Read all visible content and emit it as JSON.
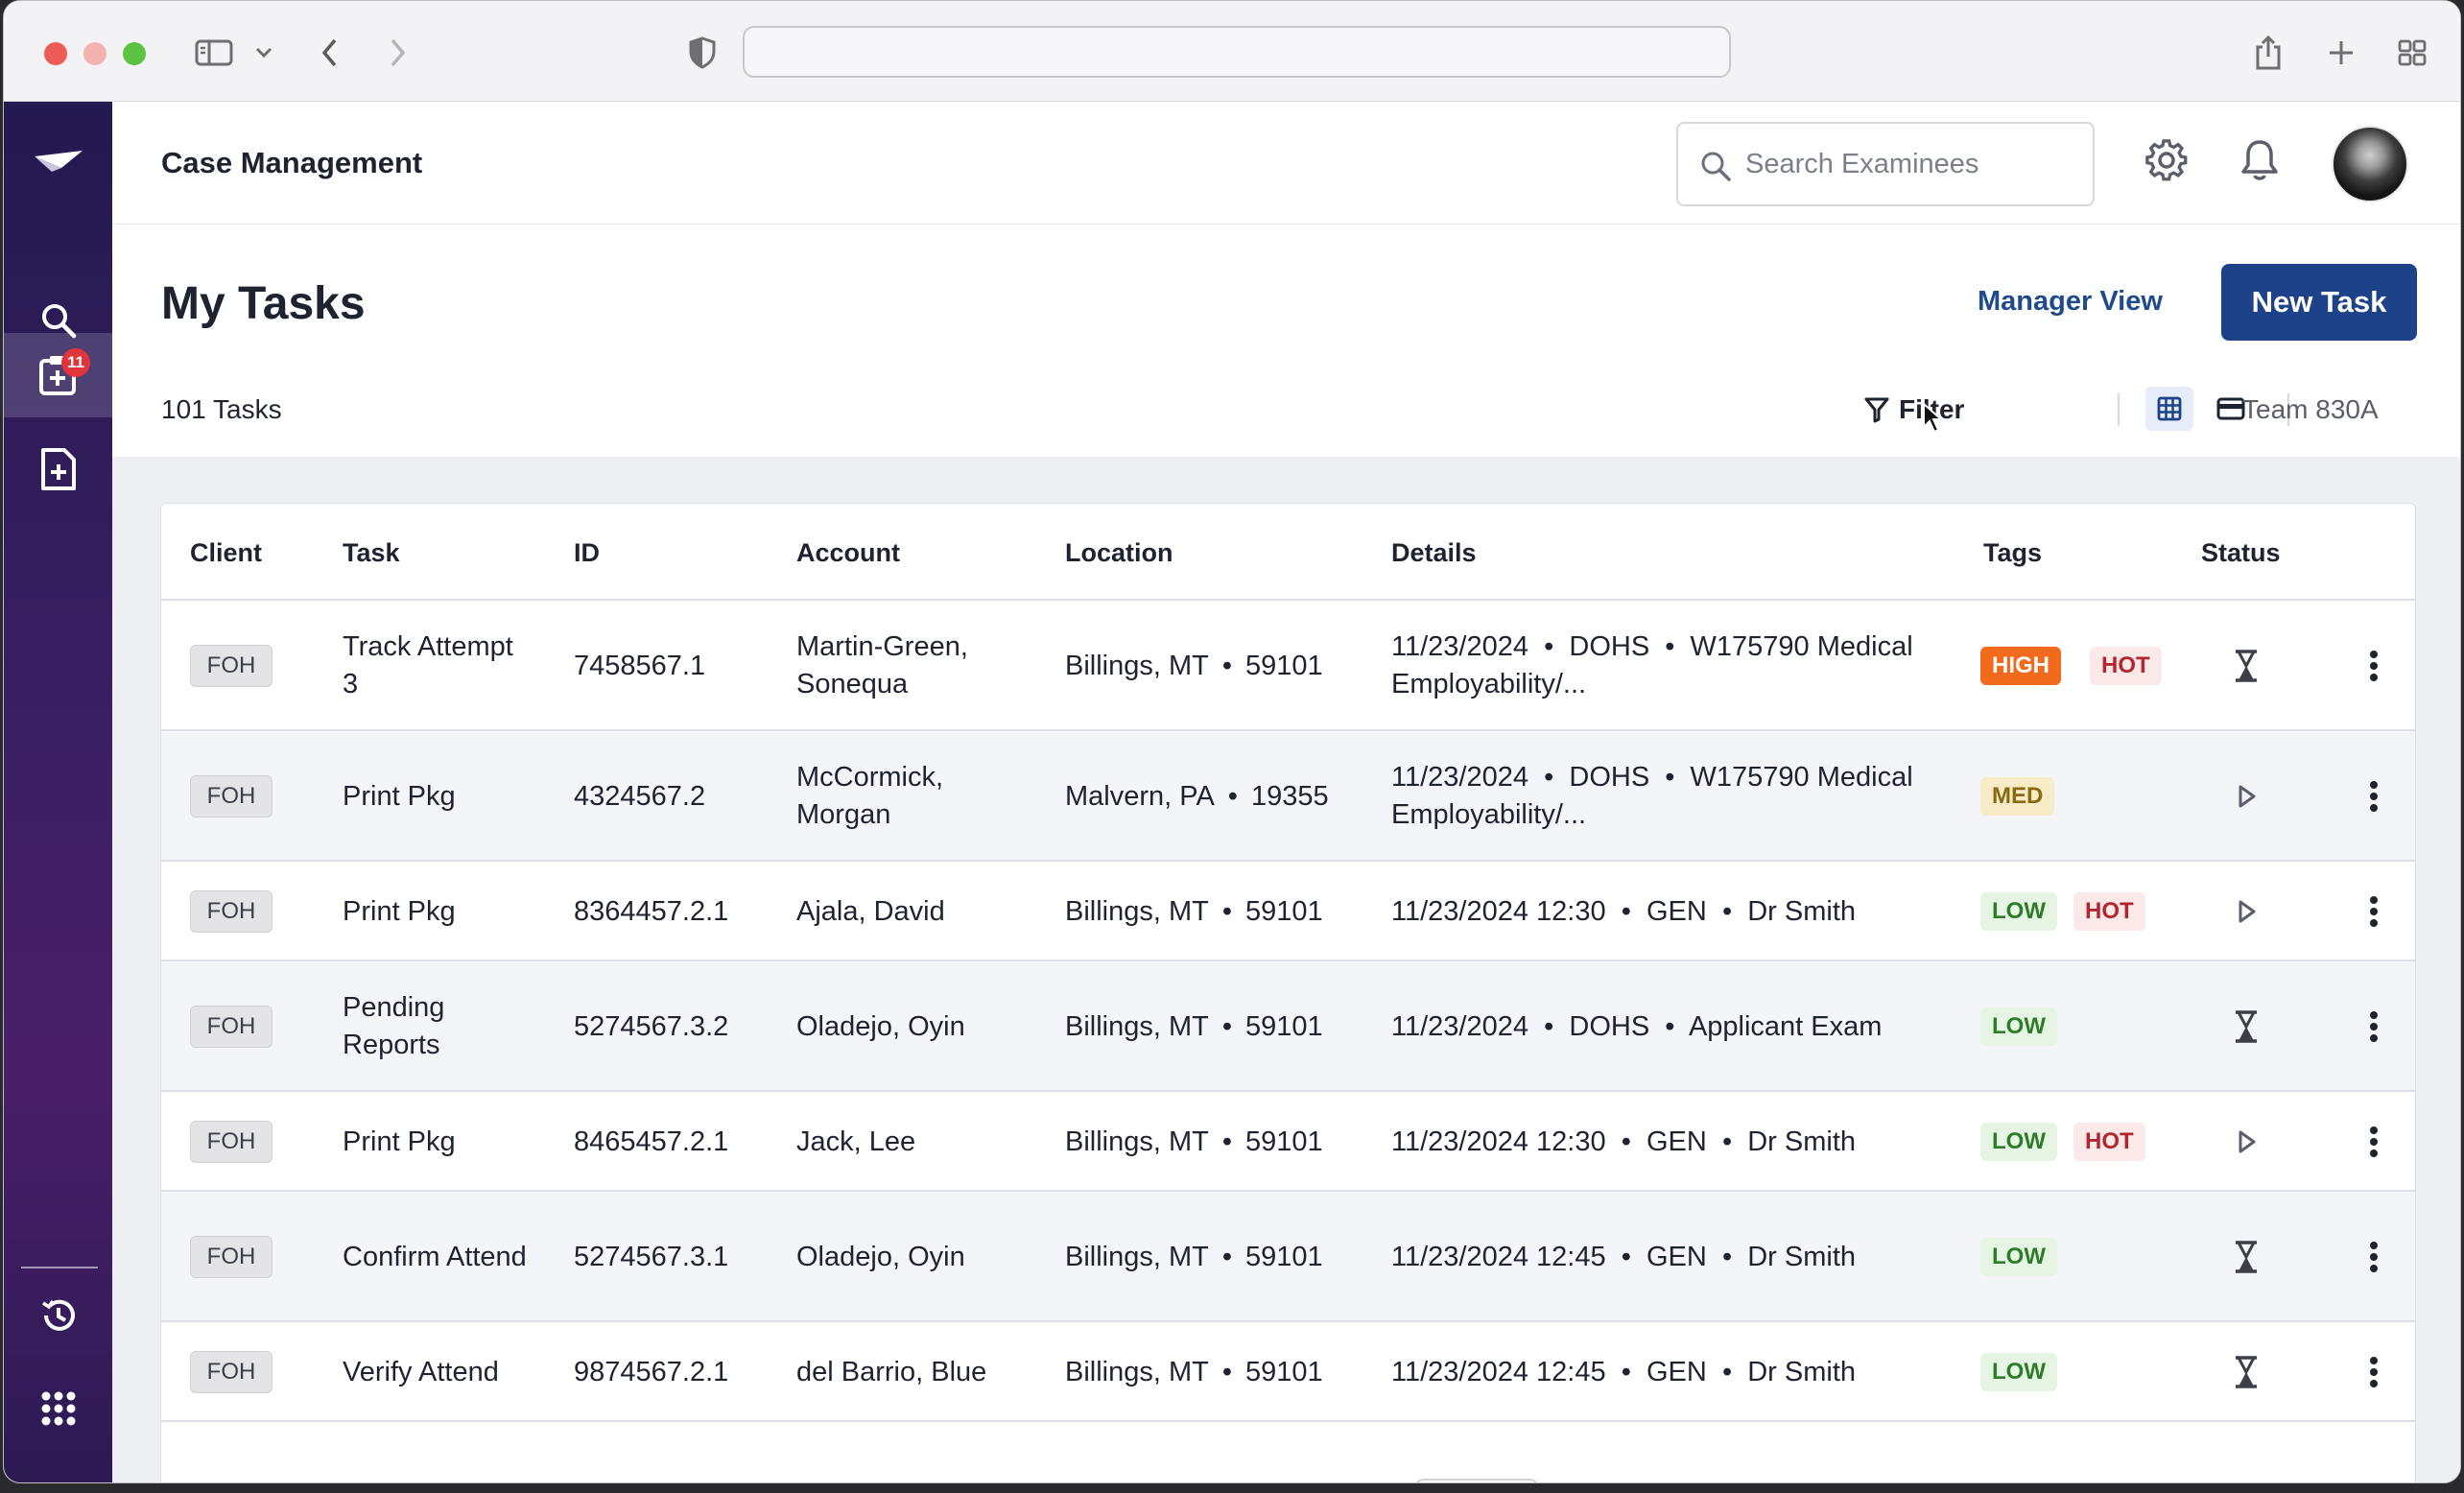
{
  "browser": {
    "url": ""
  },
  "sidebar": {
    "badge_count": "11"
  },
  "header": {
    "app_title": "Case Management",
    "search_placeholder": "Search Examinees"
  },
  "page": {
    "title": "My Tasks",
    "manager_view": "Manager View",
    "new_task": "New Task",
    "task_count": "101 Tasks",
    "filter": "Filter",
    "team": "Team 830A"
  },
  "table": {
    "columns": [
      "Client",
      "Task",
      "ID",
      "Account",
      "Location",
      "Details",
      "Tags",
      "Status"
    ],
    "rows": [
      {
        "client": "FOH",
        "task": "Track Attempt 3",
        "id": "7458567.1",
        "account": "Martin-Green, Sonequa",
        "city": "Billings, MT",
        "zip": "59101",
        "details": "11/23/2024  •  DOHS  •  W175790 Medical Employability/...",
        "tags": [
          {
            "label": "HIGH",
            "kind": "high"
          },
          {
            "label": "HOT",
            "kind": "hot"
          }
        ],
        "status": "hourglass-icon"
      },
      {
        "client": "FOH",
        "task": "Print Pkg",
        "id": "4324567.2",
        "account": "McCormick, Morgan",
        "city": "Malvern, PA",
        "zip": "19355",
        "details": "11/23/2024  •  DOHS  •  W175790 Medical Employability/...",
        "tags": [
          {
            "label": "MED",
            "kind": "med"
          }
        ],
        "status": "play-icon"
      },
      {
        "client": "FOH",
        "task": "Print Pkg",
        "id": "8364457.2.1",
        "account": "Ajala, David",
        "city": "Billings, MT",
        "zip": "59101",
        "details": "11/23/2024 12:30  •  GEN  •  Dr Smith",
        "tags": [
          {
            "label": "LOW",
            "kind": "low"
          },
          {
            "label": "HOT",
            "kind": "hot"
          }
        ],
        "status": "play-icon"
      },
      {
        "client": "FOH",
        "task": "Pending Reports",
        "id": "5274567.3.2",
        "account": "Oladejo, Oyin",
        "city": "Billings, MT",
        "zip": "59101",
        "details": "11/23/2024  •  DOHS  •  Applicant Exam",
        "tags": [
          {
            "label": "LOW",
            "kind": "low"
          }
        ],
        "status": "hourglass-icon"
      },
      {
        "client": "FOH",
        "task": "Print Pkg",
        "id": "8465457.2.1",
        "account": "Jack, Lee",
        "city": "Billings, MT",
        "zip": "59101",
        "details": "11/23/2024 12:30  •  GEN  •  Dr Smith",
        "tags": [
          {
            "label": "LOW",
            "kind": "low"
          },
          {
            "label": "HOT",
            "kind": "hot"
          }
        ],
        "status": "play-icon"
      },
      {
        "client": "FOH",
        "task": "Confirm Attend",
        "id": "5274567.3.1",
        "account": "Oladejo, Oyin",
        "city": "Billings, MT",
        "zip": "59101",
        "details": "11/23/2024 12:45  •  GEN  •  Dr Smith",
        "tags": [
          {
            "label": "LOW",
            "kind": "low"
          }
        ],
        "status": "hourglass-icon"
      },
      {
        "client": "FOH",
        "task": "Verify Attend",
        "id": "9874567.2.1",
        "account": "del Barrio, Blue",
        "city": "Billings, MT",
        "zip": "59101",
        "details": "11/23/2024 12:45  •  GEN  •  Dr Smith",
        "tags": [
          {
            "label": "LOW",
            "kind": "low"
          }
        ],
        "status": "hourglass-icon"
      }
    ]
  }
}
